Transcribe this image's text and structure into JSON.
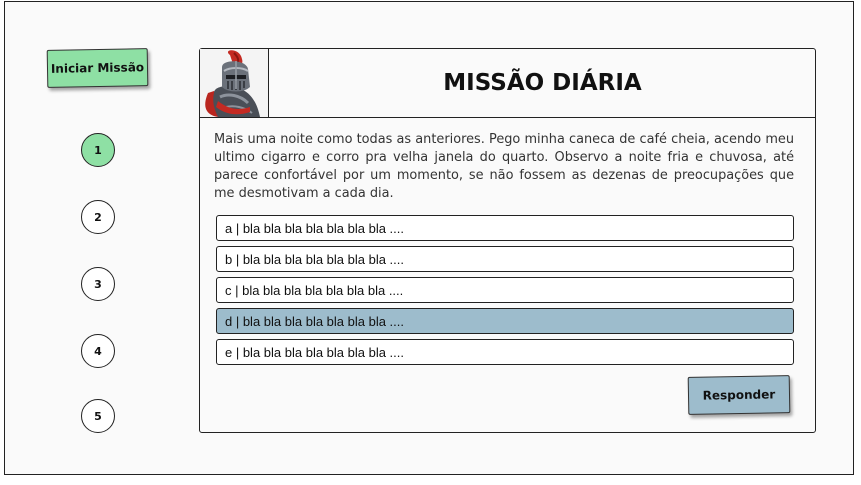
{
  "actions": {
    "start_label": "Iniciar Missão",
    "answer_label": "Responder"
  },
  "steps": [
    "1",
    "2",
    "3",
    "4",
    "5"
  ],
  "active_step": "1",
  "mission": {
    "title": "MISSÃO DIÁRIA",
    "avatar_icon": "knight-icon",
    "story": "Mais uma noite como todas as anteriores. Pego minha caneca de café cheia, acendo meu  ultimo cigarro e corro pra velha janela do quarto. Observo a noite fria e chuvosa, até parece  confortável por um momento, se não fossem as dezenas de preocupações que me  desmotivam a cada dia."
  },
  "options": [
    {
      "label": "a | bla bla bla bla bla bla bla ...."
    },
    {
      "label": "b | bla bla bla bla bla bla bla ...."
    },
    {
      "label": "c | bla bla bla bla bla bla bla ...."
    },
    {
      "label": "d | bla bla bla bla bla bla bla ...."
    },
    {
      "label": "e | bla bla bla bla bla bla bla ...."
    }
  ],
  "selected_option": "d",
  "colors": {
    "accent_green": "#8ee0a4",
    "accent_blue": "#9dbccc"
  }
}
